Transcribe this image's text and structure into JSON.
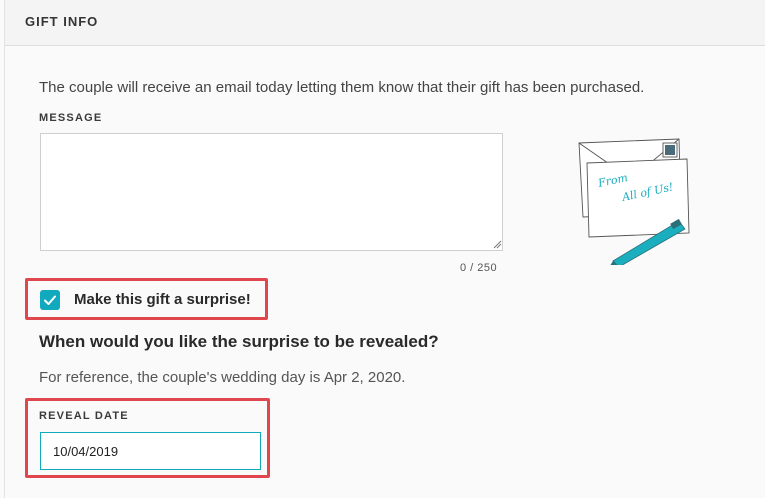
{
  "section": {
    "title": "GIFT INFO",
    "intro": "The couple will receive an email today letting them know that their gift has been purchased."
  },
  "message": {
    "label": "MESSAGE",
    "value": "",
    "counter": "0 / 250"
  },
  "illustration": {
    "icon": "envelope-card-pen-illustration",
    "handwriting_line1": "From",
    "handwriting_line2": "All of Us!"
  },
  "surprise": {
    "checked": true,
    "label": "Make this gift a surprise!",
    "question": "When would you like the surprise to be revealed?",
    "reference": "For reference, the couple's wedding day is Apr 2, 2020."
  },
  "reveal": {
    "label": "REVEAL DATE",
    "value": "10/04/2019"
  },
  "colors": {
    "accent": "#10a9bd",
    "highlight": "#e0464e"
  }
}
